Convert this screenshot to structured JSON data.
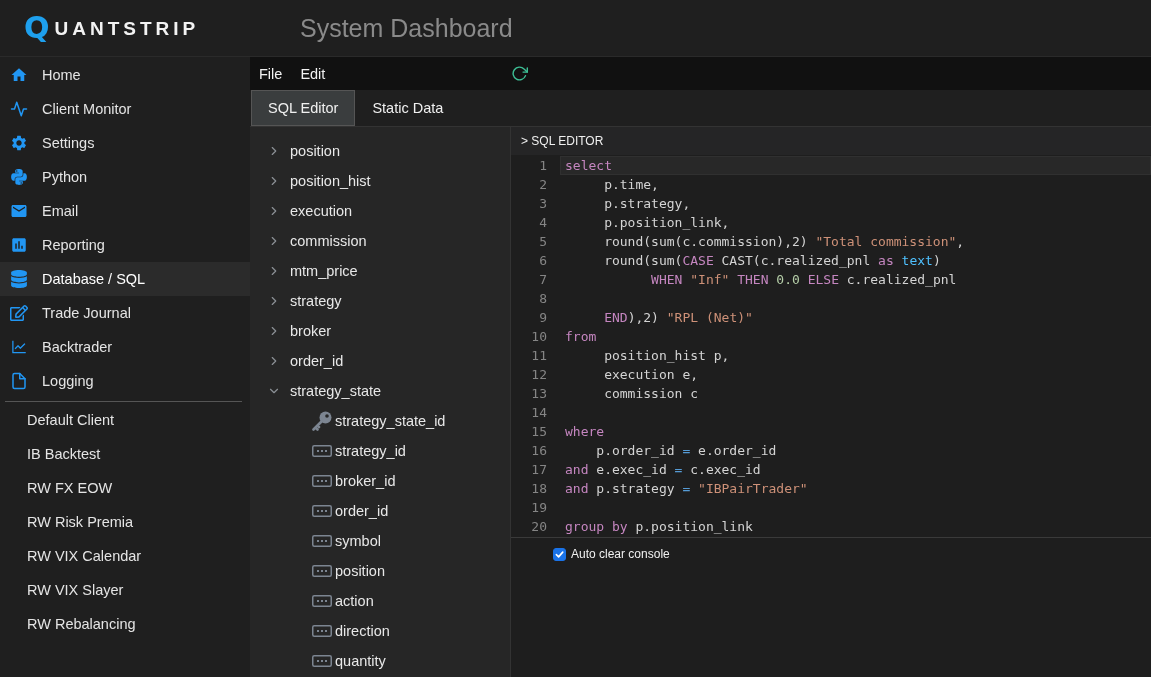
{
  "header": {
    "logo": {
      "mark": "Q",
      "name": "UANTSTRIP"
    },
    "title": "System Dashboard"
  },
  "sidebar": {
    "items": [
      {
        "label": "Home",
        "selected": false
      },
      {
        "label": "Client Monitor",
        "selected": false
      },
      {
        "label": "Settings",
        "selected": false
      },
      {
        "label": "Python",
        "selected": false
      },
      {
        "label": "Email",
        "selected": false
      },
      {
        "label": "Reporting",
        "selected": false
      },
      {
        "label": "Database / SQL",
        "selected": true
      },
      {
        "label": "Trade Journal",
        "selected": false
      },
      {
        "label": "Backtrader",
        "selected": false
      },
      {
        "label": "Logging",
        "selected": false
      }
    ],
    "clients": [
      {
        "label": "Default Client",
        "selected": false
      },
      {
        "label": "IB Backtest",
        "selected": false
      },
      {
        "label": "RW FX EOW",
        "selected": false
      },
      {
        "label": "RW Risk Premia",
        "selected": false
      },
      {
        "label": "RW VIX Calendar",
        "selected": false
      },
      {
        "label": "RW VIX Slayer",
        "selected": false
      },
      {
        "label": "RW Rebalancing",
        "selected": false
      }
    ]
  },
  "menu": [
    "File",
    "Edit"
  ],
  "tabs": [
    {
      "label": "SQL Editor",
      "selected": true
    },
    {
      "label": "Static Data",
      "selected": false
    }
  ],
  "tree": {
    "tables": [
      {
        "label": "position",
        "expanded": false
      },
      {
        "label": "position_hist",
        "expanded": false
      },
      {
        "label": "execution",
        "expanded": false
      },
      {
        "label": "commission",
        "expanded": false
      },
      {
        "label": "mtm_price",
        "expanded": false
      },
      {
        "label": "strategy",
        "expanded": false
      },
      {
        "label": "broker",
        "expanded": false
      },
      {
        "label": "order_id",
        "expanded": false
      },
      {
        "label": "strategy_state",
        "expanded": true,
        "children": [
          {
            "label": "strategy_state_id",
            "kind": "key"
          },
          {
            "label": "strategy_id",
            "kind": "column"
          },
          {
            "label": "broker_id",
            "kind": "column"
          },
          {
            "label": "order_id",
            "kind": "column"
          },
          {
            "label": "symbol",
            "kind": "column"
          },
          {
            "label": "position",
            "kind": "column"
          },
          {
            "label": "action",
            "kind": "column"
          },
          {
            "label": "direction",
            "kind": "column"
          },
          {
            "label": "quantity",
            "kind": "column"
          }
        ]
      }
    ]
  },
  "editor": {
    "title": "> SQL EDITOR",
    "lines": [
      {
        "number": "1",
        "current": true,
        "tokens": [
          {
            "kind": "keyword",
            "text": "select"
          }
        ]
      },
      {
        "number": "2",
        "current": false,
        "tokens": [
          {
            "kind": "plain",
            "text": "     p.time,"
          }
        ]
      },
      {
        "number": "3",
        "current": false,
        "tokens": [
          {
            "kind": "plain",
            "text": "     p.strategy,"
          }
        ]
      },
      {
        "number": "4",
        "current": false,
        "tokens": [
          {
            "kind": "plain",
            "text": "     p.position_link,"
          }
        ]
      },
      {
        "number": "5",
        "current": false,
        "tokens": [
          {
            "kind": "plain",
            "text": "     round(sum(c.commission),2) "
          },
          {
            "kind": "string",
            "text": "\"Total commission\""
          },
          {
            "kind": "plain",
            "text": ","
          }
        ]
      },
      {
        "number": "6",
        "current": false,
        "tokens": [
          {
            "kind": "plain",
            "text": "     round(sum("
          },
          {
            "kind": "keyword",
            "text": "CASE"
          },
          {
            "kind": "plain",
            "text": " CAST(c.realized_pnl "
          },
          {
            "kind": "keyword",
            "text": "as "
          },
          {
            "kind": "type",
            "text": "text"
          },
          {
            "kind": "plain",
            "text": ")"
          }
        ]
      },
      {
        "number": "7",
        "current": false,
        "tokens": [
          {
            "kind": "keyword",
            "text": "           WHEN "
          },
          {
            "kind": "string",
            "text": "\"Inf\" "
          },
          {
            "kind": "keyword",
            "text": "THEN "
          },
          {
            "kind": "number",
            "text": "0.0 "
          },
          {
            "kind": "keyword",
            "text": "ELSE"
          },
          {
            "kind": "plain",
            "text": " c.realized_pnl"
          }
        ]
      },
      {
        "number": "8",
        "current": false
      },
      {
        "number": "9",
        "current": false,
        "tokens": [
          {
            "kind": "keyword",
            "text": "     END"
          },
          {
            "kind": "plain",
            "text": "),2) "
          },
          {
            "kind": "string",
            "text": "\"RPL (Net)\""
          }
        ]
      },
      {
        "number": "10",
        "current": false,
        "tokens": [
          {
            "kind": "keyword",
            "text": "from"
          }
        ]
      },
      {
        "number": "11",
        "current": false,
        "tokens": [
          {
            "kind": "plain",
            "text": "     position_hist p,"
          }
        ]
      },
      {
        "number": "12",
        "current": false,
        "tokens": [
          {
            "kind": "plain",
            "text": "     execution e,"
          }
        ]
      },
      {
        "number": "13",
        "current": false,
        "tokens": [
          {
            "kind": "plain",
            "text": "     commission c"
          }
        ]
      },
      {
        "number": "14",
        "current": false
      },
      {
        "number": "15",
        "current": false,
        "tokens": [
          {
            "kind": "keyword",
            "text": "where"
          }
        ]
      },
      {
        "number": "16",
        "current": false,
        "tokens": [
          {
            "kind": "plain",
            "text": "    p.order_id "
          },
          {
            "kind": "operator",
            "text": "="
          },
          {
            "kind": "plain",
            "text": " e.order_id"
          }
        ]
      },
      {
        "number": "17",
        "current": false,
        "tokens": [
          {
            "kind": "keyword",
            "text": "and"
          },
          {
            "kind": "plain",
            "text": " e.exec_id "
          },
          {
            "kind": "operator",
            "text": "="
          },
          {
            "kind": "plain",
            "text": " c.exec_id"
          }
        ]
      },
      {
        "number": "18",
        "current": false,
        "tokens": [
          {
            "kind": "keyword",
            "text": "and"
          },
          {
            "kind": "plain",
            "text": " p.strategy "
          },
          {
            "kind": "operator",
            "text": "= "
          },
          {
            "kind": "string",
            "text": "\"IBPairTrader\""
          }
        ]
      },
      {
        "number": "19",
        "current": false
      },
      {
        "number": "20",
        "current": false,
        "tokens": [
          {
            "kind": "keyword",
            "text": "group "
          },
          {
            "kind": "keyword",
            "text": "by"
          },
          {
            "kind": "plain",
            "text": " p.position_link"
          }
        ]
      }
    ]
  },
  "console": {
    "auto_clear": {
      "label": "Auto clear console",
      "checked": true
    }
  }
}
